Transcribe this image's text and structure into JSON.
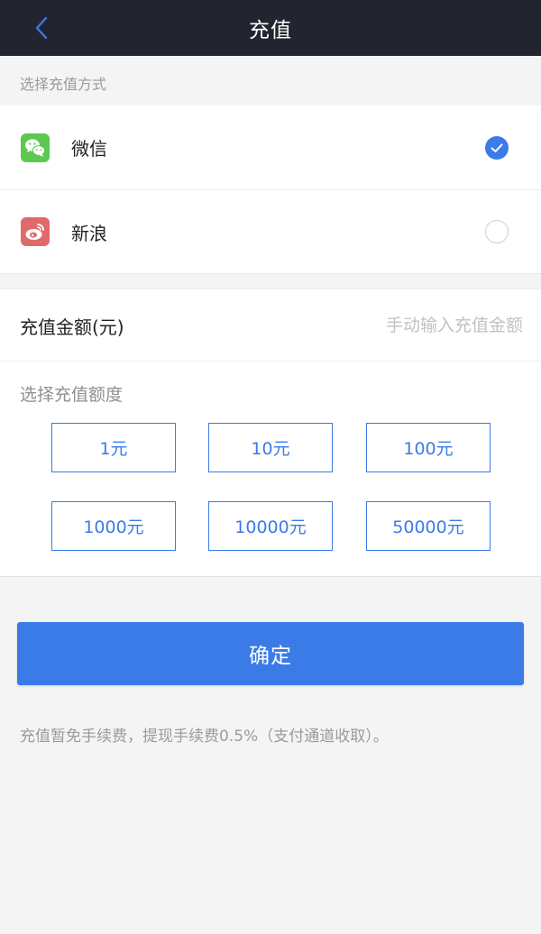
{
  "header": {
    "title": "充值",
    "back_icon": "chevron-left-icon"
  },
  "payment": {
    "section_label": "选择充值方式",
    "methods": [
      {
        "name": "微信",
        "icon": "wechat-icon",
        "selected": true
      },
      {
        "name": "新浪",
        "icon": "weibo-icon",
        "selected": false
      }
    ]
  },
  "amount": {
    "label": "充值金额(元)",
    "placeholder": "手动输入充值金额",
    "quota_label": "选择充值额度",
    "options": [
      "1元",
      "10元",
      "100元",
      "1000元",
      "10000元",
      "50000元"
    ]
  },
  "confirm_label": "确定",
  "notice": "充值暂免手续费，提现手续费0.5%（支付通道收取）。",
  "colors": {
    "accent": "#3a7be8",
    "header_bg": "#22242f",
    "wechat": "#5bc94f",
    "weibo": "#e06a6a"
  }
}
